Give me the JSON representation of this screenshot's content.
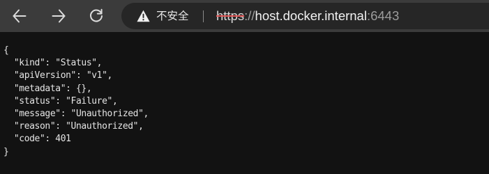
{
  "browser": {
    "nav": {
      "back_icon": "arrow-left-icon",
      "forward_icon": "arrow-right-icon",
      "reload_icon": "reload-icon"
    },
    "address_bar": {
      "security_icon": "warning-triangle-icon",
      "security_label": "不安全",
      "url": {
        "scheme": "https",
        "separator": "://",
        "host": "host.docker.internal",
        "port": ":6443"
      }
    }
  },
  "page": {
    "json_text": "{\n  \"kind\": \"Status\",\n  \"apiVersion\": \"v1\",\n  \"metadata\": {},\n  \"status\": \"Failure\",\n  \"message\": \"Unauthorized\",\n  \"reason\": \"Unauthorized\",\n  \"code\": 401\n}"
  },
  "colors": {
    "toolbar_bg": "#3b3b3b",
    "address_bar_bg": "#262626",
    "page_bg": "#121212",
    "text": "#e4e4e4",
    "insecure_strike": "#e15656"
  }
}
